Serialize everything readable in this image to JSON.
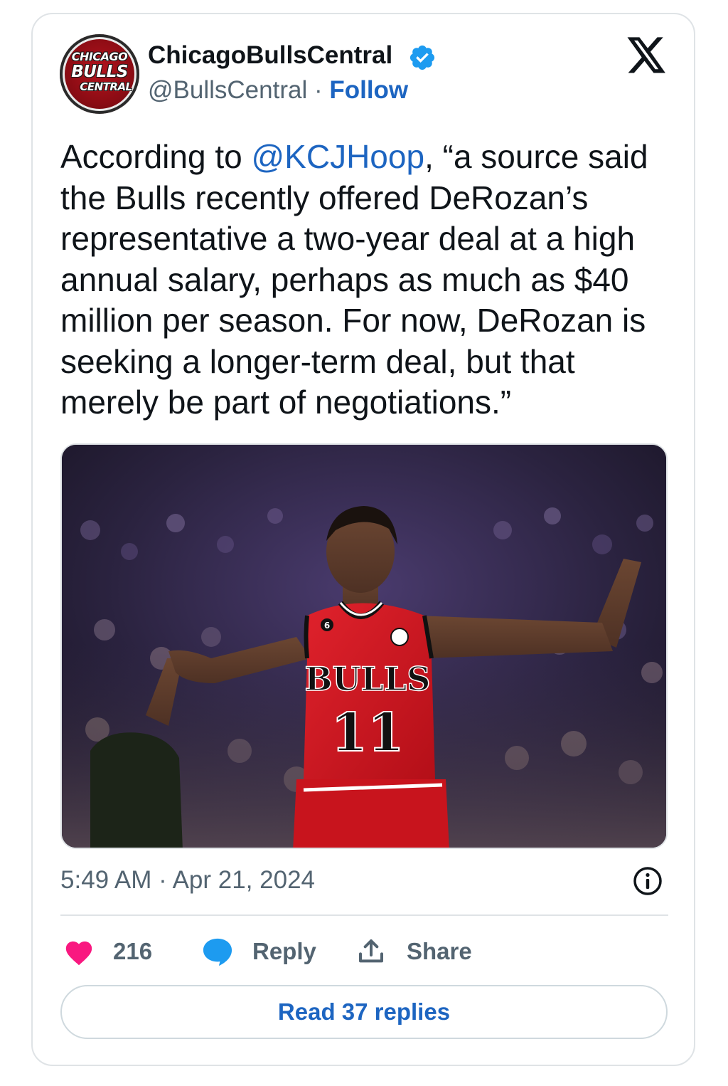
{
  "account": {
    "display_name": "ChicagoBullsCentral",
    "handle": "@BullsCentral",
    "separator": "·",
    "follow_label": "Follow",
    "verified": true,
    "avatar_lines": [
      "CHICAGO",
      "BULLS",
      "CENTRAL"
    ]
  },
  "brand_icon": "x-logo-icon",
  "tweet": {
    "text_before": "According to ",
    "mention": "@KCJHoop",
    "text_after": ", “a source said the Bulls recently offered DeRozan’s representative a two-year deal at a high annual salary, perhaps as much as $40 million per season. For now, DeRozan is seeking a longer-term deal, but that merely be part of negotiations.”"
  },
  "media": {
    "jersey_team": "BULLS",
    "jersey_number": "11",
    "jersey_patch_number": "6"
  },
  "meta": {
    "timestamp": "5:49 AM · Apr 21, 2024",
    "info_icon": "info-icon"
  },
  "actions": {
    "like_count": "216",
    "reply_label": "Reply",
    "share_label": "Share"
  },
  "read_replies_label": "Read 37 replies",
  "colors": {
    "link_blue": "#1d65c1",
    "heart_pink": "#f91880",
    "reply_bubble_blue": "#1d9bf0",
    "secondary_text": "#536471",
    "bulls_red": "#ce1126"
  }
}
